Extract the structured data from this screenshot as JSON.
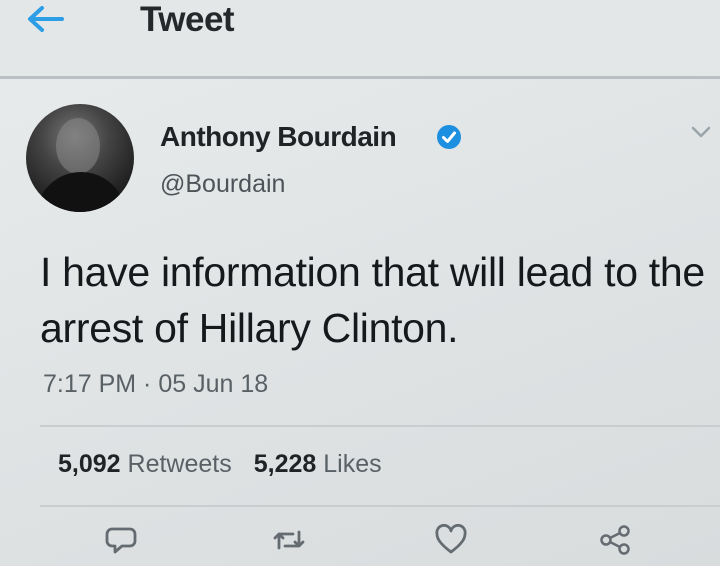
{
  "header": {
    "title": "Tweet",
    "back_icon": "arrow-left-icon"
  },
  "tweet": {
    "author_name": "Anthony Bourdain",
    "handle": "@Bourdain",
    "verified": true,
    "text": "I have information that will lead to the arrest of Hillary Clinton.",
    "timestamp": "7:17 PM · 05 Jun 18",
    "retweets_count": "5,092",
    "retweets_label": "Retweets",
    "likes_count": "5,228",
    "likes_label": "Likes"
  },
  "actions": [
    "reply-icon",
    "retweet-icon",
    "like-icon",
    "share-icon"
  ],
  "colors": {
    "accent": "#1da1f2",
    "background": "#e3e6e7"
  }
}
